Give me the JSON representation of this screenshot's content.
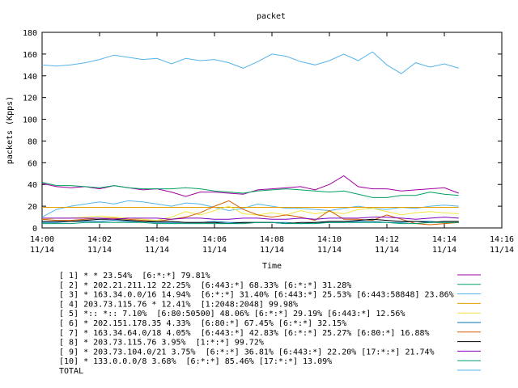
{
  "chart_data": {
    "type": "line",
    "title": "packet",
    "xlabel": "Time",
    "ylabel": "packets (Kpps)",
    "ylim": [
      0,
      180
    ],
    "yticks": [
      "0",
      "20",
      "40",
      "60",
      "80",
      "100",
      "120",
      "140",
      "160",
      "180"
    ],
    "xlim": [
      "14:00",
      "14:16"
    ],
    "xticks": [
      {
        "time": "14:00",
        "date": "11/14"
      },
      {
        "time": "14:02",
        "date": "11/14"
      },
      {
        "time": "14:04",
        "date": "11/14"
      },
      {
        "time": "14:06",
        "date": "11/14"
      },
      {
        "time": "14:08",
        "date": "11/14"
      },
      {
        "time": "14:10",
        "date": "11/14"
      },
      {
        "time": "14:12",
        "date": "11/14"
      },
      {
        "time": "14:14",
        "date": "11/14"
      },
      {
        "time": "14:16",
        "date": "11/14"
      }
    ],
    "grid": false,
    "legend_position": "bottom",
    "x": [
      "14:00:00",
      "14:00:30",
      "14:01:00",
      "14:01:30",
      "14:02:00",
      "14:02:30",
      "14:03:00",
      "14:03:30",
      "14:04:00",
      "14:04:30",
      "14:05:00",
      "14:05:30",
      "14:06:00",
      "14:06:30",
      "14:07:00",
      "14:07:30",
      "14:08:00",
      "14:08:30",
      "14:09:00",
      "14:09:30",
      "14:10:00",
      "14:10:30",
      "14:11:00",
      "14:11:30",
      "14:12:00",
      "14:12:30",
      "14:13:00",
      "14:13:30",
      "14:14:00",
      "14:14:30"
    ],
    "series": [
      {
        "name": "[ 1] * * 23.54%  [6:*:*] 79.81%",
        "color": "#a000a0",
        "values": [
          41,
          38,
          37,
          38,
          36,
          39,
          37,
          35,
          36,
          33,
          29,
          33,
          33,
          32,
          31,
          35,
          36,
          37,
          38,
          35,
          40,
          48,
          38,
          36,
          36,
          34,
          35,
          36,
          37,
          32
        ]
      },
      {
        "name": "[ 2] * 202.21.211.12 22.25%  [6:443:*] 68.33% [6:*:*] 31.28%",
        "color": "#00a060",
        "values": [
          42,
          39,
          39,
          38,
          37,
          39,
          37,
          36,
          36,
          36,
          37,
          36,
          34,
          33,
          32,
          34,
          35,
          36,
          35,
          34,
          33,
          34,
          31,
          28,
          28,
          30,
          30,
          33,
          31,
          30
        ]
      },
      {
        "name": "[ 3] * 163.34.0.0/16 14.94%  [6:*:*] 31.40% [6:443:*] 25.53% [6:443:58848] 23.86%",
        "color": "#56b4e9",
        "values": [
          10,
          17,
          20,
          22,
          24,
          22,
          25,
          24,
          22,
          20,
          23,
          22,
          19,
          16,
          18,
          22,
          20,
          18,
          18,
          17,
          16,
          18,
          20,
          18,
          17,
          19,
          18,
          20,
          21,
          20
        ]
      },
      {
        "name": "[ 4] 203.73.115.76 * 12.41%  [1:2048:2048] 99.98%",
        "color": "#e69f00",
        "values": [
          19,
          19,
          19,
          19,
          19,
          19,
          19,
          19,
          19,
          19,
          19,
          19,
          19,
          19,
          19,
          19,
          19,
          19,
          19,
          19,
          19,
          19,
          19,
          19,
          19,
          19,
          19,
          19,
          19,
          19
        ]
      },
      {
        "name": "[ 5] *:: *:: 7.10%  [6:80:50500] 48.06% [6:*:*] 29.19% [6:443:*] 12.56%",
        "color": "#f0e442",
        "values": [
          8,
          9,
          9,
          10,
          11,
          10,
          9,
          8,
          7,
          10,
          15,
          12,
          16,
          20,
          13,
          12,
          14,
          12,
          16,
          13,
          15,
          13,
          17,
          18,
          15,
          12,
          14,
          15,
          14,
          13
        ]
      },
      {
        "name": "[ 6] * 202.151.178.35 4.33%  [6:80:*] 67.45% [6:*:*] 32.15%",
        "color": "#0072b2",
        "values": [
          5,
          5,
          6,
          6,
          6,
          7,
          6,
          6,
          5,
          5,
          5,
          5,
          6,
          5,
          5,
          5,
          5,
          5,
          4,
          5,
          5,
          5,
          6,
          6,
          5,
          5,
          6,
          6,
          5,
          5
        ]
      },
      {
        "name": "[ 7] * 163.34.64.0/18 4.05%  [6:443:*] 42.83% [6:*:*] 25.27% [6:80:*] 16.88%",
        "color": "#d55e00",
        "values": [
          8,
          7,
          7,
          8,
          9,
          9,
          8,
          7,
          6,
          8,
          10,
          14,
          20,
          25,
          17,
          12,
          10,
          12,
          10,
          7,
          16,
          8,
          8,
          7,
          12,
          8,
          4,
          3,
          4,
          5
        ]
      },
      {
        "name": "[ 8] * 203.73.115.76 3.95%  [1:*:*] 99.72%",
        "color": "#000000",
        "values": [
          6,
          6,
          6,
          7,
          8,
          8,
          7,
          6,
          6,
          6,
          5,
          5,
          5,
          4,
          5,
          5,
          5,
          4,
          5,
          5,
          6,
          6,
          7,
          8,
          7,
          6,
          6,
          5,
          6,
          6
        ]
      },
      {
        "name": "[ 9] * 203.73.104.0/21 3.75%  [6:*:*] 36.81% [6:443:*] 22.20% [17:*:*] 21.74%",
        "color": "#8000c0",
        "values": [
          9,
          9,
          9,
          9,
          9,
          8,
          9,
          9,
          9,
          8,
          9,
          9,
          8,
          8,
          9,
          9,
          8,
          8,
          9,
          8,
          9,
          9,
          9,
          10,
          10,
          9,
          8,
          9,
          10,
          9
        ]
      },
      {
        "name": "[10] * 133.0.0.0/8 3.68%  [6:*:*] 85.46% [17:*:*] 13.09%",
        "color": "#009e73",
        "values": [
          4,
          4,
          4,
          5,
          5,
          5,
          5,
          5,
          4,
          4,
          4,
          4,
          4,
          4,
          4,
          5,
          5,
          4,
          4,
          4,
          5,
          5,
          5,
          5,
          5,
          4,
          4,
          5,
          5,
          5
        ]
      },
      {
        "name": "TOTAL",
        "color": "#56b4e9",
        "values": [
          150,
          149,
          150,
          152,
          155,
          159,
          157,
          155,
          156,
          151,
          156,
          154,
          155,
          152,
          147,
          153,
          160,
          158,
          153,
          150,
          154,
          160,
          154,
          162,
          150,
          142,
          152,
          148,
          151,
          147
        ]
      }
    ]
  }
}
